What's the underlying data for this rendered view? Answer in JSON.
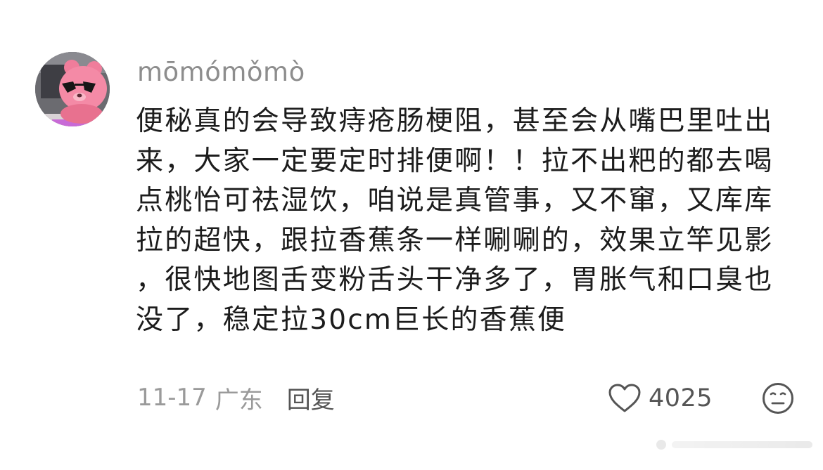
{
  "comment": {
    "username": "mōmómǒmò",
    "body_lines": [
      "便秘真的会导致痔疮肠梗阻，甚至会从嘴巴里吐出",
      "来，大家一定要定时排便啊！！拉不出粑的都去喝",
      "点桃怡可祛湿饮，咱说是真管事，又不窜，又库库",
      "拉的超快，跟拉香蕉条一样唰唰的，效果立竿见影",
      "，很快地图舌变粉舌头干净多了，胃胀气和口臭也",
      "没了，稳定拉30cm巨长的香蕉便"
    ],
    "date": "11-17",
    "region": "广东",
    "reply_label": "回复",
    "like_count": "4025"
  },
  "icons": {
    "avatar": "pink-bear-with-sunglasses-avatar",
    "like": "heart-outline-icon",
    "dislike": "neutral-face-icon"
  },
  "colors": {
    "background": "#ffffff",
    "username": "#8d8d8d",
    "body_text": "#1c1c1c",
    "meta_text": "#9a9a9a",
    "action_text": "#555555",
    "avatar_pink": "#f07d9b"
  }
}
